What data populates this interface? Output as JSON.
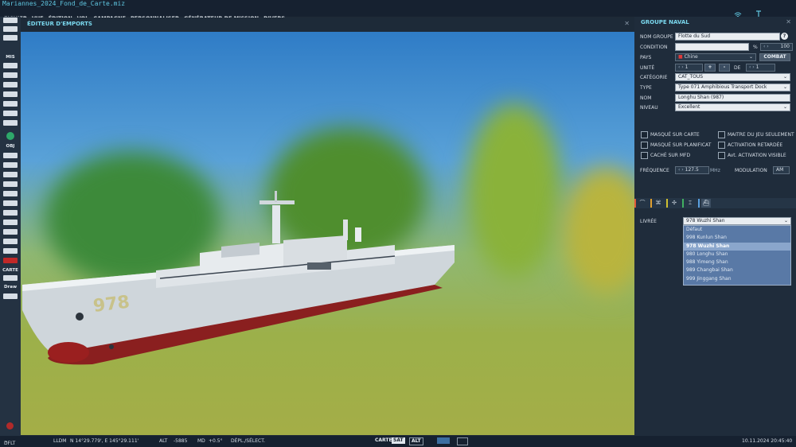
{
  "window": {
    "title": "Mariannes_2024_Fond_de_Carte.miz"
  },
  "menu": [
    "FICHIER",
    "VUE",
    "ÉDITION",
    "VOL",
    "CAMPAGNE",
    "PERSONNALISER",
    "GÉNÉRATEUR DE MISSION",
    "DIVERS"
  ],
  "left_toolbar": {
    "mis_label": "MIS",
    "obj_label": "OBJ",
    "carte_label": "CARTE",
    "draw_label": "Draw"
  },
  "viewport": {
    "title": "ÉDITEUR D'EMPORTS",
    "ship_hull_number": "978"
  },
  "panel": {
    "title": "GROUPE NAVAL",
    "help": "?",
    "group_name_label": "NOM GROUPE",
    "group_name": "Flotte du Sud",
    "condition_label": "CONDITION",
    "condition_unit": "%",
    "condition_value": "100",
    "country_label": "PAYS",
    "country": "Chine",
    "combat_button": "COMBAT",
    "unit_label": "UNITÉ",
    "unit_index": "1",
    "plus": "+",
    "minus": "-",
    "of_label": "DE",
    "unit_total": "1",
    "category_label": "CATÉGORIE",
    "category": "CAT_TOUS",
    "type_label": "TYPE",
    "type": "Type 071 Amphibious Transport Dock",
    "name_label": "NOM",
    "name": "Longhu Shan (987)",
    "level_label": "NIVEAU",
    "level": "Excellent",
    "cb_hidden_map": "MASQUÉ SUR CARTE",
    "cb_gamemaster": "MAÎTRE DU JEU SEULEMENT",
    "cb_hidden_planner": "MASQUÉ SUR PLANIFICAT",
    "cb_late_activation": "ACTIVATION RETARDÉE",
    "cb_hidden_mfd": "CACHÉ SUR MFD",
    "cb_visible_before": "Avt. ACTIVATION VISIBLE",
    "frequency_label": "FRÉQUENCE",
    "frequency": "127.5",
    "frequency_unit": "MHz",
    "modulation_label": "MODULATION",
    "modulation": "AM",
    "livery_label": "LIVRÉE",
    "livery": "978 Wuzhi Shan",
    "livery_options": [
      "Défaut",
      "998 Kunlun Shan",
      "978 Wuzhi Shan",
      "980 Longhu Shan",
      "988 Yimeng Shan",
      "989 Changbai Shan",
      "999 Jinggang Shan"
    ],
    "livery_selected_index": 2
  },
  "status": {
    "layer": "DFLT",
    "coord_mode": "LLDM",
    "coord": "N 14°29.779', E 145°29.111'",
    "alt_label": "ALT",
    "alt": "-5885",
    "md_label": "MD",
    "md": "+0.5°",
    "mode": "DÉPL./SÉLECT.",
    "map_btn": "CARTE",
    "sat_btn": "SAT",
    "alt_btn": "ALT",
    "datetime": "10.11.2024 20:45:40"
  },
  "colors": {
    "accent": "#7ad8ee",
    "panel": "#1f2c3b",
    "selection": "#8aa6cc"
  }
}
